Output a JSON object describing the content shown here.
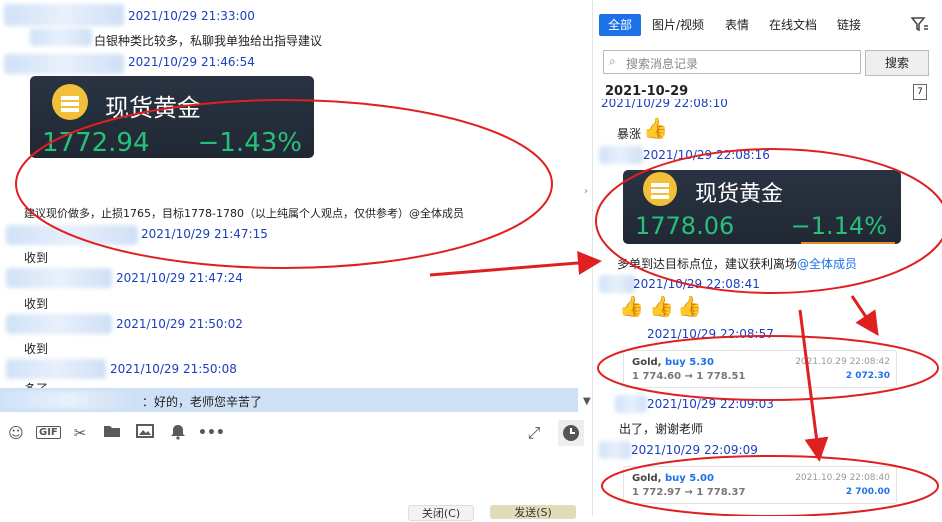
{
  "left": {
    "messages": [
      {
        "ts": "2021/10/29 21:33:00"
      },
      {
        "text": "白银种类比较多，私聊我单独给出指导建议"
      },
      {
        "ts": "2021/10/29 21:46:54"
      },
      {
        "card": {
          "title": "现货黄金",
          "price": "1772.94",
          "change": "−1.43%"
        }
      },
      {
        "text": "建议现价做多，止损1765，目标1778-1780（以上纯属个人观点，仅供参考）@全体成员"
      },
      {
        "ts": "2021/10/29 21:47:15"
      },
      {
        "text": "收到"
      },
      {
        "ts": "2021/10/29 21:47:24"
      },
      {
        "text": "收到"
      },
      {
        "ts": "2021/10/29 21:50:02"
      },
      {
        "text": "收到"
      },
      {
        "ts": "2021/10/29 21:50:08"
      },
      {
        "text": "多了"
      }
    ],
    "quote_reply": "：好的，老师您辛苦了",
    "toolbar_icons": [
      "emoji-icon",
      "gif-icon",
      "scissors-icon",
      "folder-icon",
      "image-icon",
      "bell-icon",
      "more-icon"
    ],
    "expand_icon": "expand-icon",
    "history_icon": "clock-icon",
    "close_button": "关闭(C)",
    "send_button": "发送(S)"
  },
  "right": {
    "tabs": [
      "全部",
      "图片/视频",
      "表情",
      "在线文档",
      "链接"
    ],
    "active_tab": "全部",
    "search_placeholder": "搜索消息记录",
    "search_button": "搜索",
    "date_header": "2021-10-29",
    "messages": [
      {
        "ts": "2021/10/29 22:08:10"
      },
      {
        "text": "暴涨"
      },
      {
        "ts": "2021/10/29 22:08:16"
      },
      {
        "card": {
          "title": "现货黄金",
          "price": "1778.06",
          "change": "−1.14%"
        }
      },
      {
        "text": "多单到达目标点位，建议获利离场",
        "mention": "@全体成员"
      },
      {
        "ts": "2021/10/29 22:08:41"
      },
      {
        "ts": "2021/10/29 22:08:57"
      },
      {
        "trade": {
          "symbol": "Gold,",
          "side": "buy 5.30",
          "prices": "1 774.60 → 1 778.51",
          "time": "2021.10.29 22:08:42",
          "profit": "2 072.30"
        }
      },
      {
        "ts": "2021/10/29 22:09:03"
      },
      {
        "text": "出了，谢谢老师"
      },
      {
        "ts": "2021/10/29 22:09:09"
      },
      {
        "trade": {
          "symbol": "Gold,",
          "side": "buy 5.00",
          "prices": "1 772.97 → 1 778.37",
          "time": "2021.10.29 22:08:40",
          "profit": "2 700.00"
        }
      }
    ]
  },
  "colors": {
    "accent": "#1e72e8",
    "annotation": "#e02020",
    "timestamp": "#1a3fbf",
    "gain": "#27c07a"
  }
}
